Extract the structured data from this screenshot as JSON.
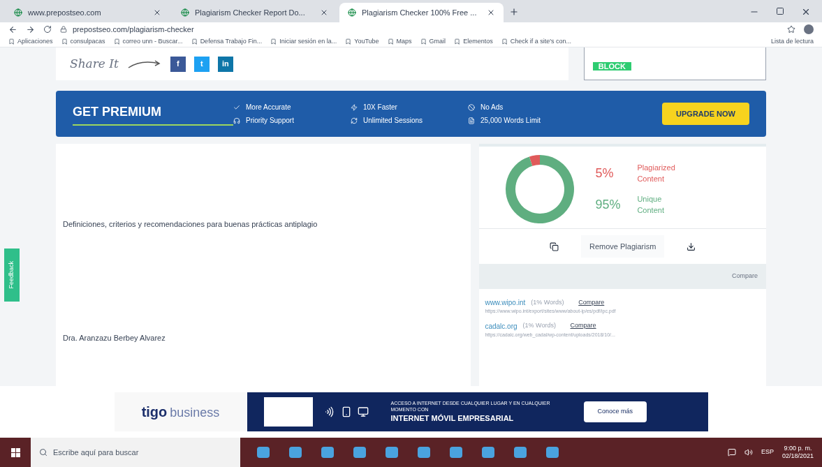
{
  "browser": {
    "tabs": [
      {
        "title": "www.prepostseo.com",
        "selected": false
      },
      {
        "title": "Plagiarism Checker Report Do...",
        "selected": false
      },
      {
        "title": "Plagiarism Checker 100% Free ...",
        "selected": true
      }
    ],
    "address": "prepostseo.com/plagiarism-checker",
    "bookmarks": [
      "Aplicaciones",
      "consulpacas",
      "correo unn - Buscar...",
      "Defensa Trabajo Fin...",
      "Iniciar sesión en la...",
      "YouTube",
      "Maps",
      "Gmail",
      "Elementos",
      "Check if a site's con..."
    ],
    "reading_list": "Lista de lectura"
  },
  "share": {
    "label": "Share It",
    "networks": [
      {
        "kind": "facebook",
        "label": "f"
      },
      {
        "kind": "twitter",
        "label": "t"
      },
      {
        "kind": "linkedin",
        "label": "in"
      }
    ],
    "side_badge": "BLOCK"
  },
  "premium": {
    "title": "GET PREMIUM",
    "features": [
      {
        "kind": "check",
        "label": "More Accurate"
      },
      {
        "kind": "support",
        "label": "Priority Support"
      },
      {
        "kind": "bolt",
        "label": "10X Faster"
      },
      {
        "kind": "refresh",
        "label": "Unlimited Sessions"
      },
      {
        "kind": "noads",
        "label": "No Ads"
      },
      {
        "kind": "doc",
        "label": "25,000 Words Limit"
      }
    ],
    "button": "UPGRADE NOW"
  },
  "document": {
    "lines": [
      "Definiciones, criterios y recomendaciones para buenas prácticas antiplagio",
      "Dra. Aranzazu Berbey Alvarez"
    ]
  },
  "feedback": "Feedback",
  "result": {
    "chart_data": {
      "type": "donut",
      "categories": [
        "Plagiarized Content",
        "Unique Content"
      ],
      "values": [
        5,
        95
      ]
    },
    "stats": [
      {
        "value": "5%",
        "color": "#e05a5a"
      },
      {
        "value": "95%",
        "color": "#5fae80"
      }
    ],
    "button": "Remove Plagiarism",
    "header_link": "Compare",
    "sources": [
      {
        "domain": "www.wipo.int",
        "share": "(1% Words)",
        "action": "Compare",
        "url": "https://www.wipo.int/export/sites/www/about-ip/es/pdf/ipc.pdf"
      },
      {
        "domain": "cadalc.org",
        "share": "(1% Words)",
        "action": "Compare",
        "url": "https://cadalc.org/web_cadal/wp-content/uploads/2018/10/..."
      }
    ]
  },
  "ad": {
    "brand": "tigo",
    "brand_suffix": "business",
    "headline": "ACCESO A INTERNET DESDE CUALQUIER LUGAR Y EN CUALQUIER MOMENTO CON",
    "title": "INTERNET MÓVIL EMPRESARIAL",
    "button": "Conoce más"
  },
  "taskbar": {
    "search_placeholder": "Escribe aquí para buscar",
    "language": "ESP",
    "time": "9:00 p. m.",
    "date": "02/18/2021"
  }
}
